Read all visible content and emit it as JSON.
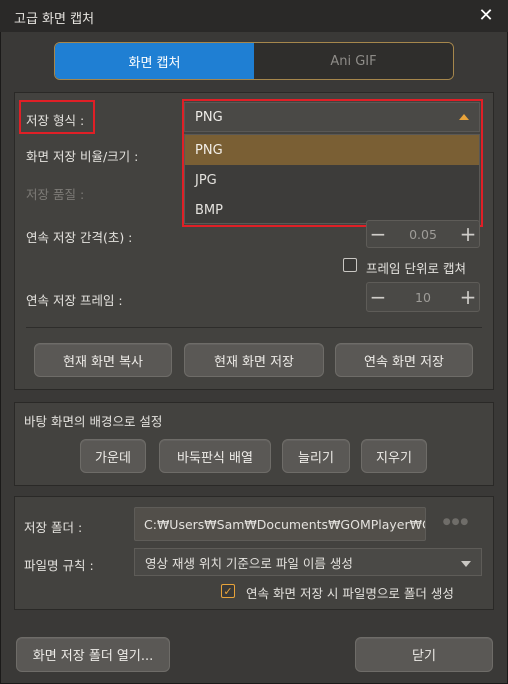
{
  "window": {
    "title": "고급 화면 캡처",
    "close_glyph": "✕"
  },
  "tabs": [
    {
      "label": "화면 캡처",
      "active": true
    },
    {
      "label": "Ani GIF",
      "active": false
    }
  ],
  "format": {
    "label": "저장 형식 :",
    "selected": "PNG",
    "options": [
      "PNG",
      "JPG",
      "BMP"
    ]
  },
  "ratio_label": "화면 저장 비율/크기 :",
  "quality_label": "저장 품질 :",
  "interval": {
    "label": "연속 저장 간격(초) :",
    "value": "0.05",
    "minus": "−",
    "plus": "+"
  },
  "frame_unit": {
    "label": "프레임 단위로 캡쳐",
    "checked": false
  },
  "frames": {
    "label": "연속 저장 프레임 :",
    "value": "10",
    "minus": "−",
    "plus": "+"
  },
  "capture_buttons": {
    "copy": "현재 화면 복사",
    "save": "현재 화면 저장",
    "continuous": "연속 화면 저장"
  },
  "wallpaper": {
    "heading": "바탕 화면의 배경으로 설정",
    "center": "가운데",
    "tile": "바둑판식 배열",
    "stretch": "늘리기",
    "clear": "지우기"
  },
  "save_folder": {
    "label": "저장 폴더 :",
    "path": "C:₩Users₩Sam₩Documents₩GOMPlayer₩Capture",
    "more_glyph": "●●●"
  },
  "filename_rule": {
    "label": "파일명 규칙 :",
    "value": "영상 재생 위치 기준으로 파일 이름 생성"
  },
  "folder_option": {
    "label": "연속 화면 저장 시 파일명으로 폴더 생성",
    "checked": true
  },
  "footer": {
    "open_folder": "화면 저장 폴더 열기...",
    "close": "닫기"
  },
  "colors": {
    "accent_tab": "#1f7fd3",
    "highlight": "#e01f26",
    "selected_option": "#7a5f34",
    "orange": "#e8a33a"
  },
  "icons": {
    "close": "close-icon",
    "dropdown": "caret-up-icon",
    "more": "ellipsis-icon",
    "check": "check-icon"
  }
}
